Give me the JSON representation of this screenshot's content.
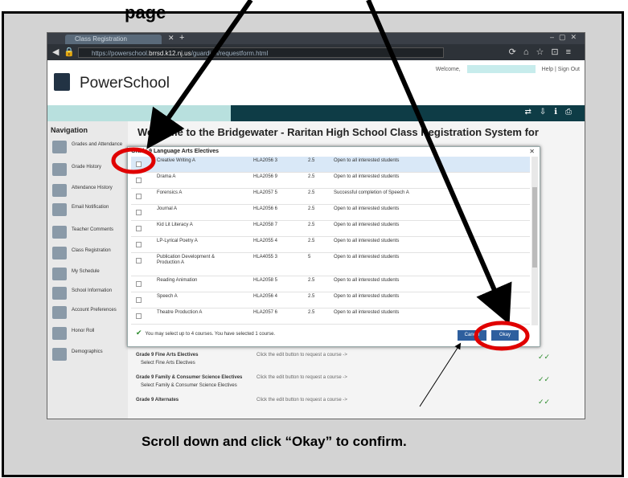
{
  "instruction_top_fragment": "page",
  "caption": "Scroll down and click “Okay” to confirm.",
  "browser": {
    "tab_title": "Class Registration",
    "url_prefix": "https://powerschool.",
    "url_domain": "brrsd.k12.nj.us",
    "url_suffix": "/guardian/requestform.html"
  },
  "powerschool": {
    "logo": "PowerSchool",
    "welcome_label": "Welcome,",
    "help": "Help",
    "sign_out": "Sign Out"
  },
  "sidebar": {
    "title": "Navigation",
    "items": [
      {
        "label": "Grades and Attendance",
        "icon": "grades-icon"
      },
      {
        "label": "Grade History",
        "icon": "history-icon"
      },
      {
        "label": "Attendance History",
        "icon": "attendance-icon"
      },
      {
        "label": "Email Notification",
        "icon": "email-icon"
      },
      {
        "label": "Teacher Comments",
        "icon": "comments-icon"
      },
      {
        "label": "Class Registration",
        "icon": "registration-icon"
      },
      {
        "label": "My Schedule",
        "icon": "schedule-icon"
      },
      {
        "label": "School Information",
        "icon": "school-icon"
      },
      {
        "label": "Account Preferences",
        "icon": "preferences-icon"
      },
      {
        "label": "Honor Roll",
        "icon": "honor-icon"
      },
      {
        "label": "Demographics",
        "icon": "demographics-icon"
      }
    ]
  },
  "main": {
    "welcome": "Welcome to the Bridgewater - Raritan High School Class Registration System for",
    "bg_sections": [
      {
        "heading": "Grade 9 Fine Arts Electives",
        "sub": "Select Fine Arts Electives",
        "msg": "Click the edit button to request a course ->"
      },
      {
        "heading": "Grade 9 Family & Consumer Science Electives",
        "sub": "Select Family & Consumer Science Electives",
        "msg": "Click the edit button to request a course ->"
      },
      {
        "heading": "Grade 9 Alternates",
        "sub": "",
        "msg": "Click the edit button to request a course ->"
      }
    ]
  },
  "modal": {
    "title": "Grade 9 Language Arts Electives",
    "courses": [
      {
        "name": "Creative Writing A",
        "code": "HLA2056 3",
        "credits": "2.5",
        "prereq": "Open to all interested students",
        "selected": true
      },
      {
        "name": "Drama A",
        "code": "HLA2056 9",
        "credits": "2.5",
        "prereq": "Open to all interested students",
        "selected": false
      },
      {
        "name": "Forensics A",
        "code": "HLA2057 5",
        "credits": "2.5",
        "prereq": "Successful completion of Speech A",
        "selected": false
      },
      {
        "name": "Journal A",
        "code": "HLA2056 6",
        "credits": "2.5",
        "prereq": "Open to all interested students",
        "selected": false
      },
      {
        "name": "Kid Lit Literacy A",
        "code": "HLA2058 7",
        "credits": "2.5",
        "prereq": "Open to all interested students",
        "selected": false
      },
      {
        "name": "LP-Lyrical Poetry A",
        "code": "HLA2055 4",
        "credits": "2.5",
        "prereq": "Open to all interested students",
        "selected": false
      },
      {
        "name": "Publication Development & Production A",
        "code": "HLA4055 3",
        "credits": "5",
        "prereq": "Open to all interested students",
        "selected": false
      },
      {
        "name": "Reading Animation",
        "code": "HLA2058 5",
        "credits": "2.5",
        "prereq": "Open to all interested students",
        "selected": false
      },
      {
        "name": "Speech A",
        "code": "HLA2056 4",
        "credits": "2.5",
        "prereq": "Open to all interested students",
        "selected": false
      },
      {
        "name": "Theatre Production A",
        "code": "HLA2057 6",
        "credits": "2.5",
        "prereq": "Open to all interested students",
        "selected": false
      }
    ],
    "status": "You may select up to 4 courses. You have selected 1 course.",
    "cancel": "Cancel",
    "okay": "Okay"
  },
  "colors": {
    "annotation_red": "#e00000",
    "teal_bar": "#0e3c46",
    "button_blue": "#2e5f9e"
  }
}
